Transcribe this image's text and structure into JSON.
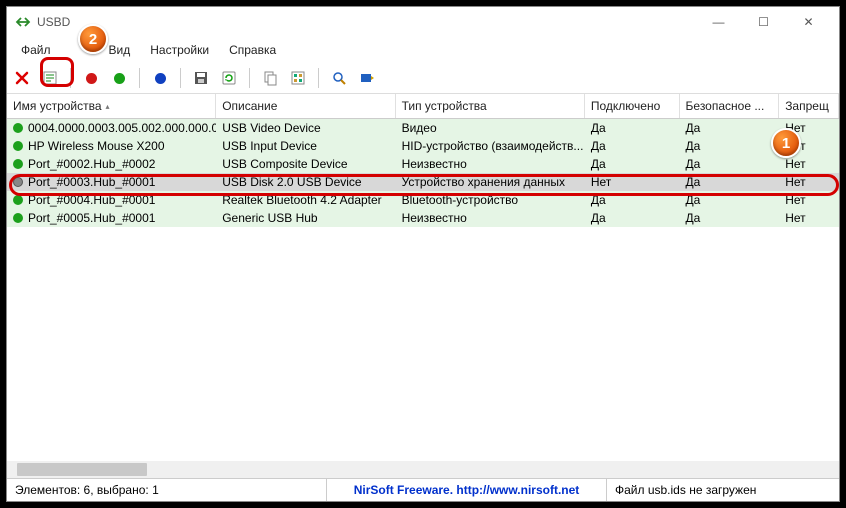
{
  "window": {
    "title": "USBD",
    "minimize": "—",
    "maximize": "☐",
    "close": "✕"
  },
  "menu": {
    "file": "Файл",
    "view": "Вид",
    "settings": "Настройки",
    "help": "Справка"
  },
  "toolbar": {
    "icons": [
      "red-x",
      "properties",
      "red-dot",
      "green-dot",
      "blue-dot",
      "save",
      "refresh",
      "copy",
      "options",
      "find",
      "about"
    ]
  },
  "columns": {
    "name": "Имя устройства",
    "desc": "Описание",
    "type": "Тип устройства",
    "conn": "Подключено",
    "safe": "Безопасное ...",
    "deny": "Запрещ"
  },
  "rows": [
    {
      "status": "green",
      "name": "0004.0000.0003.005.002.000.000.0...",
      "desc": "USB Video Device",
      "type": "Видео",
      "conn": "Да",
      "safe": "Да",
      "deny": "Нет"
    },
    {
      "status": "green",
      "name": "HP Wireless Mouse X200",
      "desc": "USB Input Device",
      "type": "HID-устройство (взаимодейств...",
      "conn": "Да",
      "safe": "Да",
      "deny": "Нет"
    },
    {
      "status": "green",
      "name": "Port_#0002.Hub_#0002",
      "desc": "USB Composite Device",
      "type": "Неизвестно",
      "conn": "Да",
      "safe": "Да",
      "deny": "Нет"
    },
    {
      "status": "gray",
      "selected": true,
      "name": "Port_#0003.Hub_#0001",
      "desc": "USB Disk 2.0 USB Device",
      "type": "Устройство хранения данных",
      "conn": "Нет",
      "safe": "Да",
      "deny": "Нет"
    },
    {
      "status": "green",
      "name": "Port_#0004.Hub_#0001",
      "desc": "Realtek Bluetooth 4.2 Adapter",
      "type": "Bluetooth-устройство",
      "conn": "Да",
      "safe": "Да",
      "deny": "Нет"
    },
    {
      "status": "green",
      "name": "Port_#0005.Hub_#0001",
      "desc": "Generic USB Hub",
      "type": "Неизвестно",
      "conn": "Да",
      "safe": "Да",
      "deny": "Нет"
    }
  ],
  "status": {
    "count": "Элементов: 6, выбрано: 1",
    "credit": "NirSoft Freeware.  http://www.nirsoft.net",
    "ids": "Файл usb.ids не загружен"
  },
  "annotations": {
    "callout1": "1",
    "callout2": "2"
  }
}
